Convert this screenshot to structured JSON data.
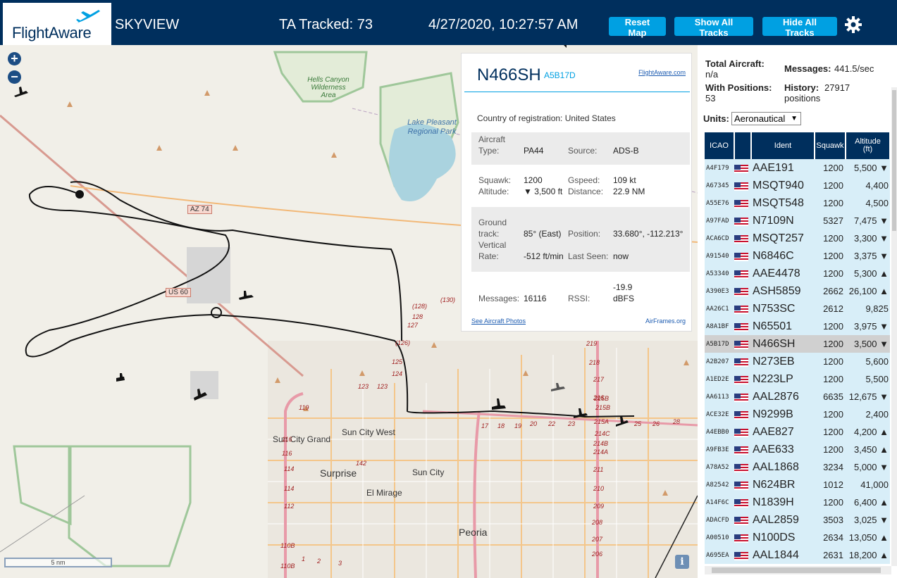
{
  "header": {
    "logo": "FlightAware",
    "app_name": "SKYVIEW",
    "ta_tracked": "TA Tracked: 73",
    "clock": "4/27/2020, 10:27:57 AM",
    "buttons": {
      "reset": "Reset Map",
      "show_all": "Show All Tracks",
      "hide_all": "Hide All Tracks"
    },
    "settings_icon": "gear-icon"
  },
  "map": {
    "zoom_in": "+",
    "zoom_out": "−",
    "labels": {
      "hells_canyon": "Hells Canyon Wilderness Area",
      "lake_pleasant": "Lake Pleasant Regional Park",
      "sun_city_west": "Sun City West",
      "sun_city_grand": "Sun City Grand",
      "surprise": "Surprise",
      "sun_city": "Sun City",
      "el_mirage": "El Mirage",
      "peoria": "Peoria"
    },
    "shields": {
      "az74": "AZ 74",
      "us60": "US 60"
    },
    "route_numbers": [
      "(128)",
      "(130)",
      "128",
      "127",
      "(126)",
      "125",
      "124",
      "123",
      "123",
      "119",
      "116",
      "116",
      "114",
      "114",
      "112",
      "110B",
      "110B",
      "142",
      "219",
      "218",
      "217",
      "216",
      "215B",
      "215B",
      "215A",
      "214C",
      "214B",
      "214A",
      "211",
      "210",
      "209",
      "208",
      "207",
      "206",
      "17",
      "18",
      "19",
      "20",
      "22",
      "23",
      "25",
      "26",
      "28",
      "1",
      "2",
      "3"
    ],
    "scale": "5 nm",
    "info_icon": "i"
  },
  "selected": {
    "ident": "N466SH",
    "icao": "A5B17D",
    "fa_link": "FlightAware.com",
    "country_label": "Country of registration:",
    "country": "United States",
    "aircraft_type_label": "Aircraft Type:",
    "aircraft_type_label_1": "Aircraft",
    "aircraft_type_label_2": "Type:",
    "aircraft_type": "PA44",
    "source_label": "Source:",
    "source": "ADS-B",
    "squawk_label": "Squawk:",
    "squawk": "1200",
    "altitude_label": "Altitude:",
    "altitude": "▼ 3,500 ft",
    "gspeed_label": "Gspeed:",
    "gspeed": "109 kt",
    "distance_label": "Distance:",
    "distance": "22.9 NM",
    "ground_track_label_1": "Ground",
    "ground_track_label_2": "track:",
    "ground_track": "85° (East)",
    "position_label": "Position:",
    "position": "33.680°, -112.213°",
    "vrate_label_1": "Vertical",
    "vrate_label_2": "Rate:",
    "vrate": "-512 ft/min",
    "last_seen_label": "Last Seen:",
    "last_seen": "now",
    "messages_label": "Messages:",
    "messages": "16116",
    "rssi_label": "RSSI:",
    "rssi_1": "-19.9",
    "rssi_2": "dBFS",
    "photos_link": "See Aircraft Photos",
    "airframes_link": "AirFrames.org"
  },
  "stats": {
    "total_label": "Total Aircraft:",
    "total": "n/a",
    "messages_label": "Messages:",
    "messages": "441.5/sec",
    "with_pos_label": "With Positions:",
    "with_pos": "53",
    "history_label": "History:",
    "history_1": "27917",
    "history_2": "positions",
    "units_label": "Units:",
    "units": "Aeronautical"
  },
  "table": {
    "headers": [
      "ICAO",
      "",
      "Ident",
      "Squawk",
      "Altitude (ft)"
    ],
    "header_altitude_1": "Altitude",
    "header_altitude_2": "(ft)",
    "rows": [
      {
        "icao": "A4F179",
        "ident": "AAE191",
        "squawk": "1200",
        "alt": "5,500 ▼"
      },
      {
        "icao": "A67345",
        "ident": "MSQT940",
        "squawk": "1200",
        "alt": "4,400"
      },
      {
        "icao": "A55E76",
        "ident": "MSQT548",
        "squawk": "1200",
        "alt": "4,500"
      },
      {
        "icao": "A97FAD",
        "ident": "N7109N",
        "squawk": "5327",
        "alt": "7,475 ▼"
      },
      {
        "icao": "ACA6CD",
        "ident": "MSQT257",
        "squawk": "1200",
        "alt": "3,300 ▼"
      },
      {
        "icao": "A91540",
        "ident": "N6846C",
        "squawk": "1200",
        "alt": "3,375 ▼"
      },
      {
        "icao": "A53340",
        "ident": "AAE4478",
        "squawk": "1200",
        "alt": "5,300 ▲"
      },
      {
        "icao": "A390E3",
        "ident": "ASH5859",
        "squawk": "2662",
        "alt": "26,100 ▲"
      },
      {
        "icao": "AA26C1",
        "ident": "N753SC",
        "squawk": "2612",
        "alt": "9,825"
      },
      {
        "icao": "A8A1BF",
        "ident": "N65501",
        "squawk": "1200",
        "alt": "3,975 ▼"
      },
      {
        "icao": "A5B17D",
        "ident": "N466SH",
        "squawk": "1200",
        "alt": "3,500 ▼",
        "selected": true
      },
      {
        "icao": "A2B207",
        "ident": "N273EB",
        "squawk": "1200",
        "alt": "5,600"
      },
      {
        "icao": "A1ED2E",
        "ident": "N223LP",
        "squawk": "1200",
        "alt": "5,500"
      },
      {
        "icao": "AA6113",
        "ident": "AAL2876",
        "squawk": "6635",
        "alt": "12,675 ▼"
      },
      {
        "icao": "ACE32E",
        "ident": "N9299B",
        "squawk": "1200",
        "alt": "2,400"
      },
      {
        "icao": "A4EBB0",
        "ident": "AAE827",
        "squawk": "1200",
        "alt": "4,200 ▲"
      },
      {
        "icao": "A9FB3E",
        "ident": "AAE633",
        "squawk": "1200",
        "alt": "3,450 ▲"
      },
      {
        "icao": "A78A52",
        "ident": "AAL1868",
        "squawk": "3234",
        "alt": "5,000 ▼"
      },
      {
        "icao": "A82542",
        "ident": "N624BR",
        "squawk": "1012",
        "alt": "41,000"
      },
      {
        "icao": "A14F6C",
        "ident": "N1839H",
        "squawk": "1200",
        "alt": "6,400 ▲"
      },
      {
        "icao": "ADACFD",
        "ident": "AAL2859",
        "squawk": "3503",
        "alt": "3,025 ▼"
      },
      {
        "icao": "A00510",
        "ident": "N100DS",
        "squawk": "2634",
        "alt": "13,050 ▲"
      },
      {
        "icao": "A695EA",
        "ident": "AAL1844",
        "squawk": "2631",
        "alt": "18,200 ▲"
      }
    ]
  }
}
